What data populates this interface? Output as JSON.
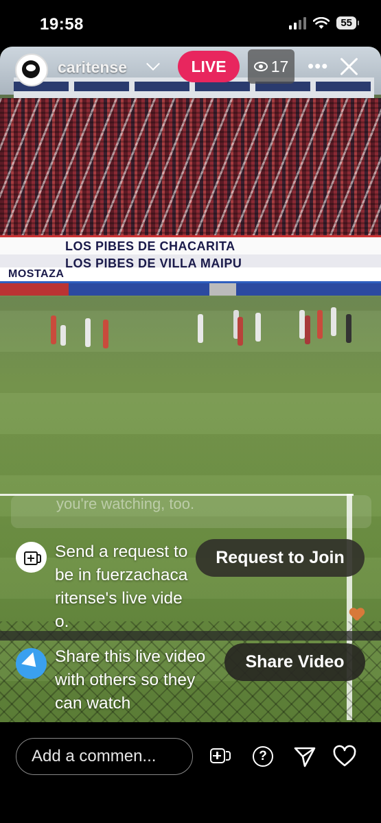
{
  "status_bar": {
    "time": "19:58",
    "battery": "55"
  },
  "live": {
    "username": "caritense",
    "live_label": "LIVE",
    "viewer_count": "17"
  },
  "scene": {
    "banner_1": "LOS PIBES DE CHACARITA",
    "banner_2": "LOS PIBES DE VILLA MAIPU",
    "banner_3": "MOSTAZA"
  },
  "overlay": {
    "faded_comment": "you're watching, too.",
    "request": {
      "text": "Send a request to be in fuerzachacaritense's live video.",
      "button": "Request to Join"
    },
    "share": {
      "text": "Share this live video with others so they can watch",
      "button": "Share Video"
    }
  },
  "bottom_bar": {
    "comment_placeholder": "Add a commen..."
  },
  "icons": {
    "eye": "eye-icon",
    "more": "more-icon",
    "close": "close-icon",
    "request": "camera-plus-icon",
    "share": "send-icon",
    "add_video": "video-add-icon",
    "question": "question-icon",
    "send": "send-outline-icon",
    "like": "heart-outline-icon"
  },
  "colors": {
    "live_badge": "#e8265e",
    "share_icon_bg": "#3aa0ef"
  }
}
